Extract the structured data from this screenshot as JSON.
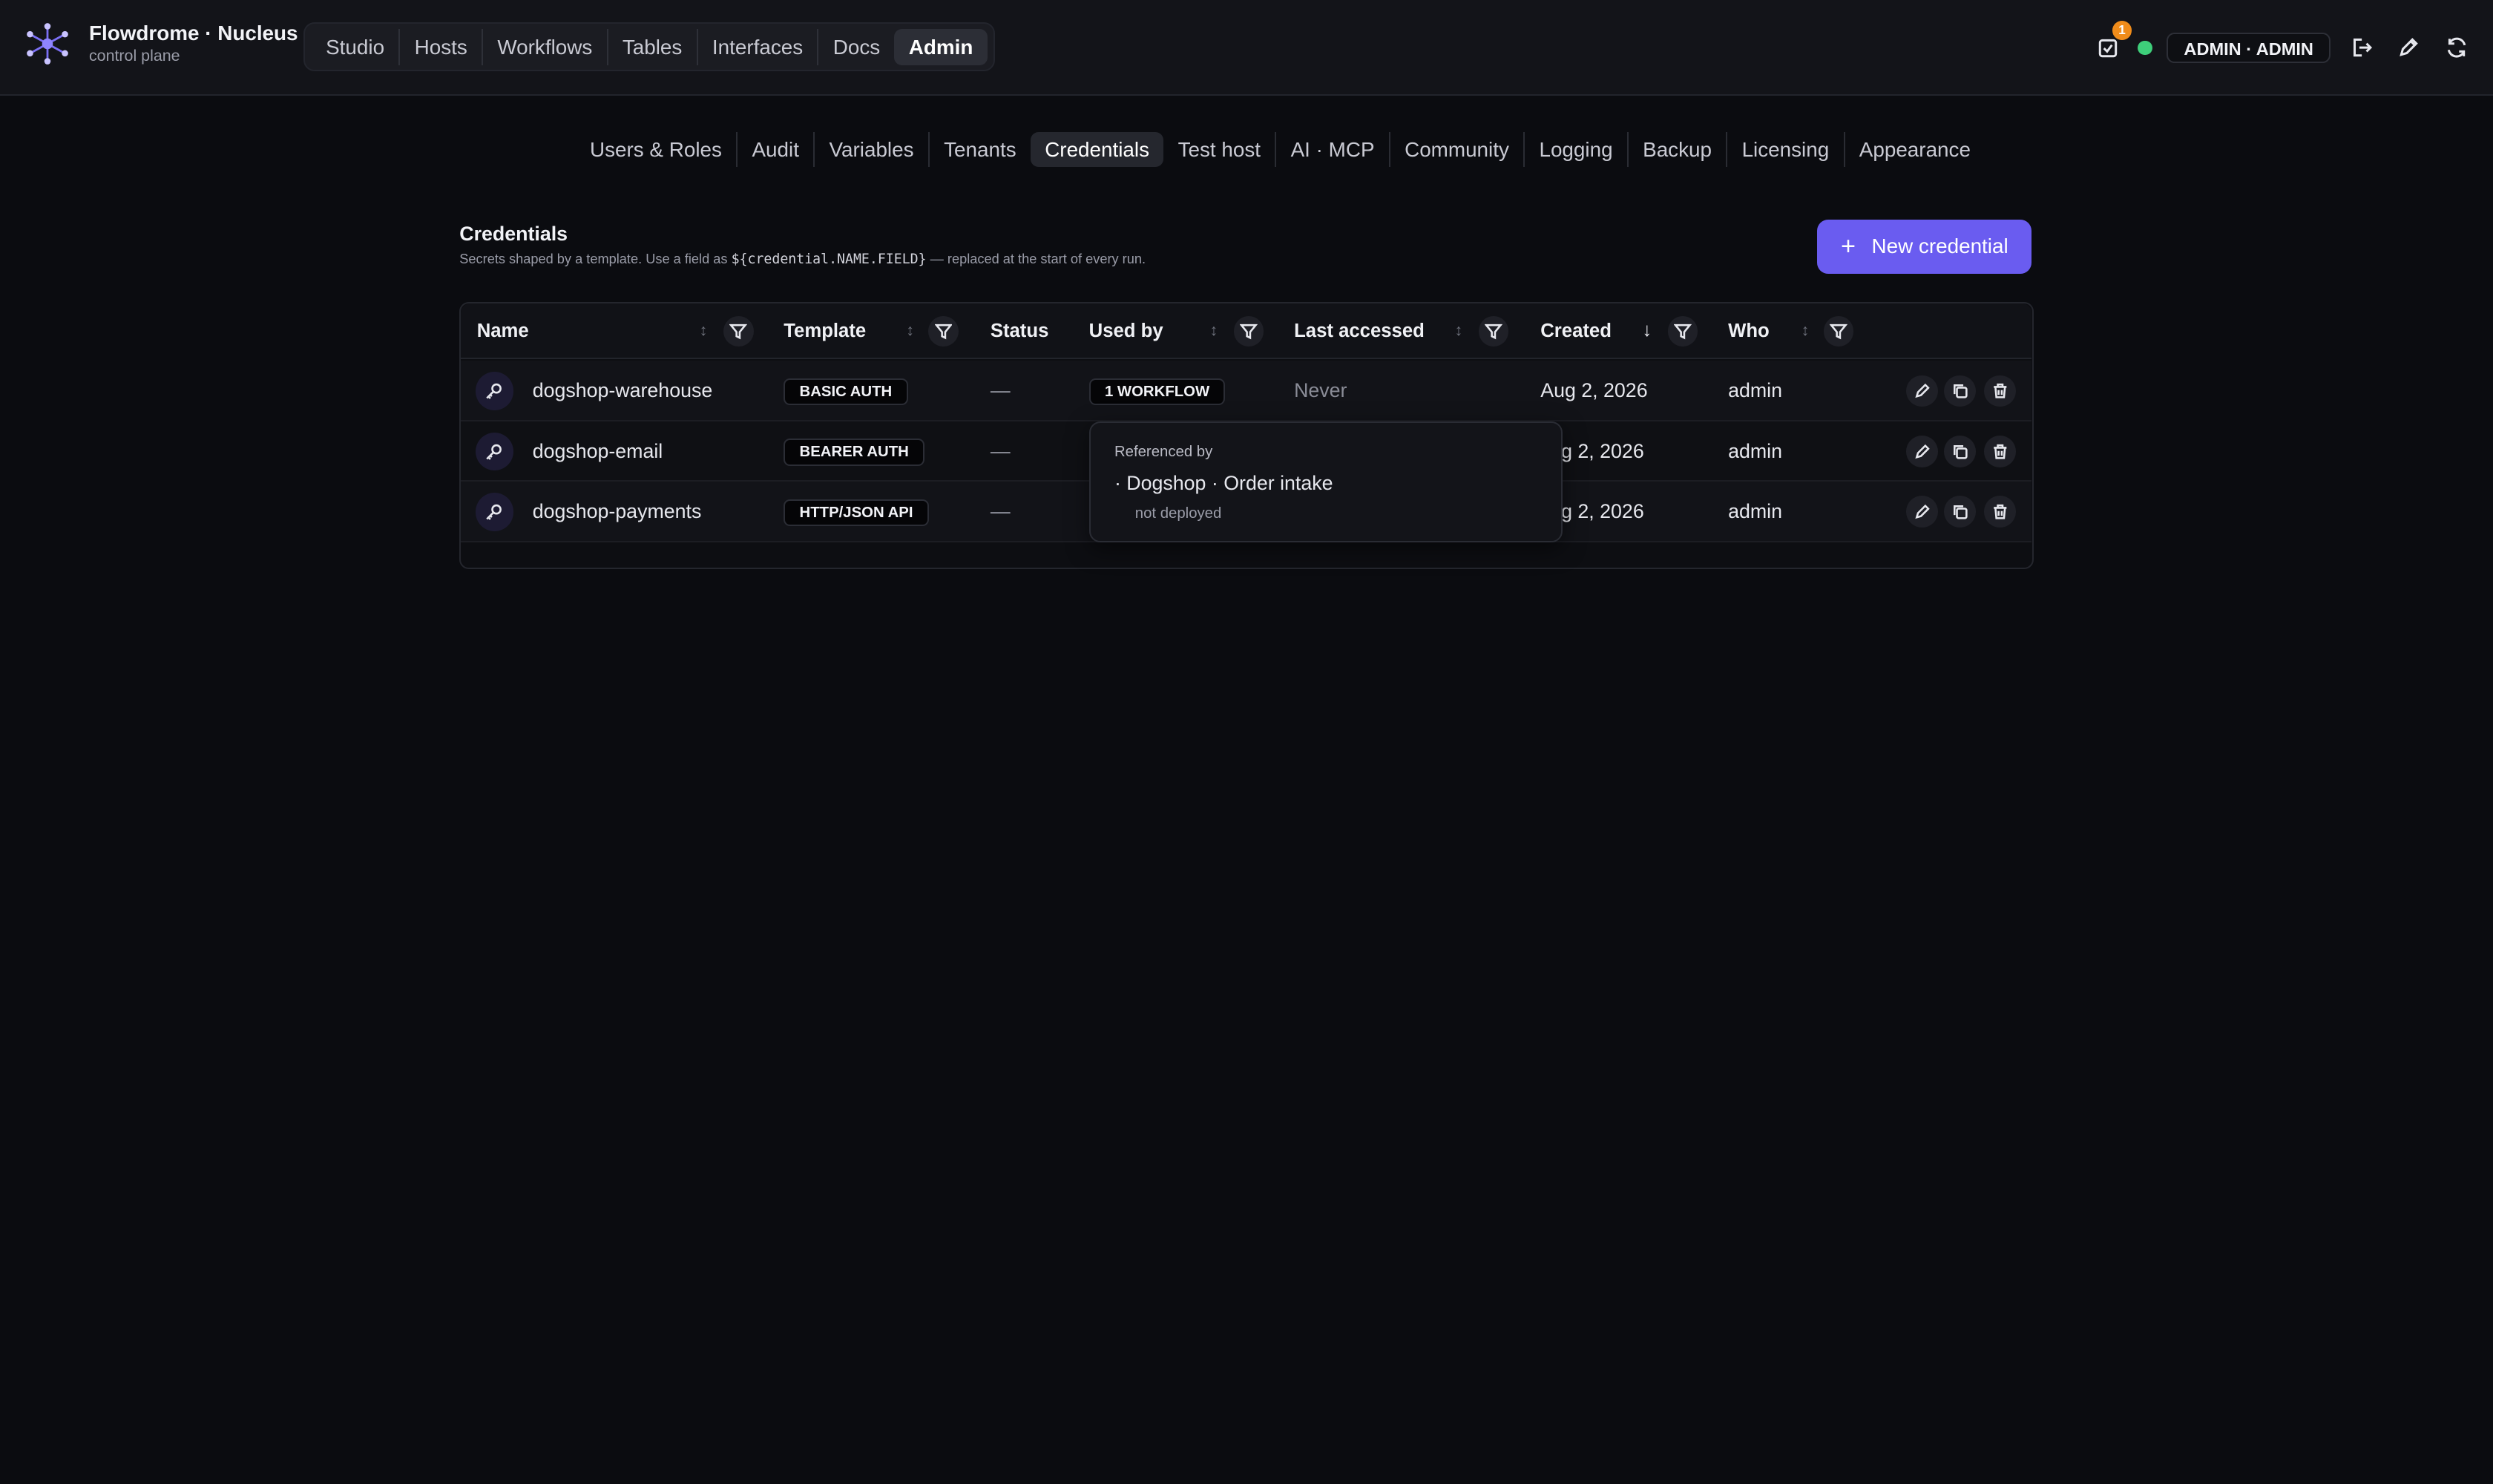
{
  "app": {
    "title": "Flowdrome · Nucleus",
    "subtitle": "control plane"
  },
  "main_nav": [
    "Studio",
    "Hosts",
    "Workflows",
    "Tables",
    "Interfaces",
    "Docs",
    "Admin"
  ],
  "main_nav_active": "Admin",
  "header_right": {
    "notification_count": "1",
    "user_label": "ADMIN · ADMIN",
    "status_color": "#3ecf7a"
  },
  "admin_tabs": [
    "Users & Roles",
    "Audit",
    "Variables",
    "Tenants",
    "Credentials",
    "Test host",
    "AI · MCP",
    "Community",
    "Logging",
    "Backup",
    "Licensing",
    "Appearance"
  ],
  "admin_tabs_active": "Credentials",
  "section": {
    "title": "Credentials",
    "desc_before": "Secrets shaped by a template. Use a field as ",
    "desc_code": "${credential.NAME.FIELD}",
    "desc_after": " — replaced at the start of every run.",
    "new_button": "New credential",
    "accent": "#6a5cf0"
  },
  "table": {
    "columns": [
      "Name",
      "Template",
      "Status",
      "Used by",
      "Last accessed",
      "Created",
      "Who"
    ],
    "rows": [
      {
        "name": "dogshop-warehouse",
        "template": "BASIC AUTH",
        "status": "—",
        "used_by": "1 WORKFLOW",
        "last_accessed": "Never",
        "created": "Aug 2, 2026",
        "who": "admin"
      },
      {
        "name": "dogshop-email",
        "template": "BEARER AUTH",
        "status": "—",
        "used_by": "",
        "last_accessed": "",
        "created": "g 2, 2026",
        "who": "admin"
      },
      {
        "name": "dogshop-payments",
        "template": "HTTP/JSON API",
        "status": "—",
        "used_by": "",
        "last_accessed": "",
        "created": "g 2, 2026",
        "who": "admin"
      }
    ]
  },
  "tooltip": {
    "title": "Referenced by",
    "item": "· Dogshop · Order intake",
    "status": "not deployed"
  }
}
